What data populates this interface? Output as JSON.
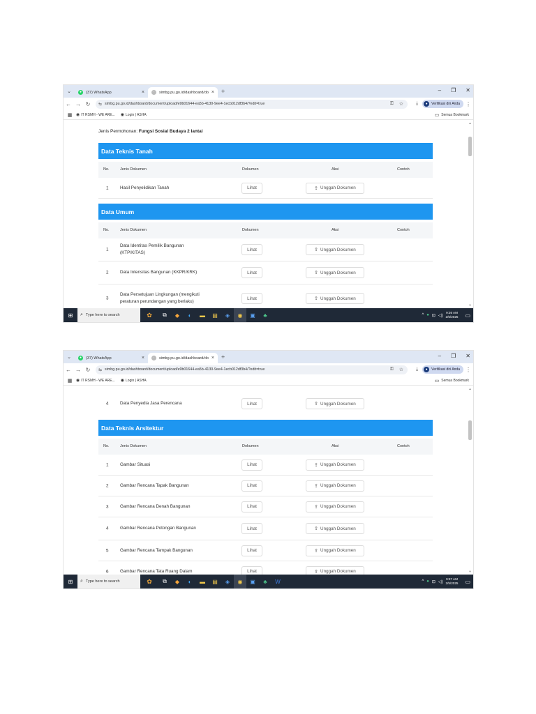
{
  "browser": {
    "tab1_label": "(37) WhatsApp",
    "tab2_label": "simbg.pu.go.id/dashboard/do",
    "url": "simbg.pu.go.id/dashboard/document/upload/e9b01644-ea5b-4130-9ee4-1ecb012df3b4/?edit=true",
    "profile_label": "Verifikasi diri Anda",
    "bookmark1": "IT RSMH - WE ARE...",
    "bookmark2": "Login | ASHA",
    "all_bookmarks": "Semua Bookmark"
  },
  "taskbar": {
    "search_placeholder": "Type here to search",
    "time1": "9:36 AM",
    "date1": "2/5/2025",
    "time2": "9:37 AM",
    "date2": "2/5/2025"
  },
  "table_headers": {
    "no": "No.",
    "jenis": "Jenis Dokumen",
    "dokumen": "Dokumen",
    "aksi": "Aksi",
    "contoh": "Contoh"
  },
  "buttons": {
    "lihat": "Lihat",
    "unggah": "Unggah Dokumen"
  },
  "shot1": {
    "jenis_label": "Jenis Permohonan:",
    "jenis_value": "Fungsi Sosial Budaya 2 lantai",
    "section1": "Data Teknis Tanah",
    "section1_rows": [
      {
        "no": "1",
        "doc": "Hasil Penyelidikan Tanah"
      }
    ],
    "section2": "Data Umum",
    "section2_rows": [
      {
        "no": "1",
        "doc": "Data Identitas Pemilik Bangunan (KTP/KITAS)"
      },
      {
        "no": "2",
        "doc": "Data Intensitas Bangunan (KKPR/KRK)"
      },
      {
        "no": "3",
        "doc": "Data Persetujuan Lingkungan (mengikuti peraturan perundangan yang berlaku)"
      }
    ]
  },
  "shot2": {
    "top_row": {
      "no": "4",
      "doc": "Data Penyedia Jasa Perencana"
    },
    "section": "Data Teknis Arsitektur",
    "rows": [
      {
        "no": "1",
        "doc": "Gambar Situasi"
      },
      {
        "no": "2",
        "doc": "Gambar Rencana Tapak Bangunan"
      },
      {
        "no": "3",
        "doc": "Gambar Rencana Denah Bangunan"
      },
      {
        "no": "4",
        "doc": "Gambar Rencana Potongan Bangunan"
      },
      {
        "no": "5",
        "doc": "Gambar Rencana Tampak Bangunan"
      },
      {
        "no": "6",
        "doc": "Gambar Rencana Tata Ruang Dalam"
      }
    ]
  }
}
